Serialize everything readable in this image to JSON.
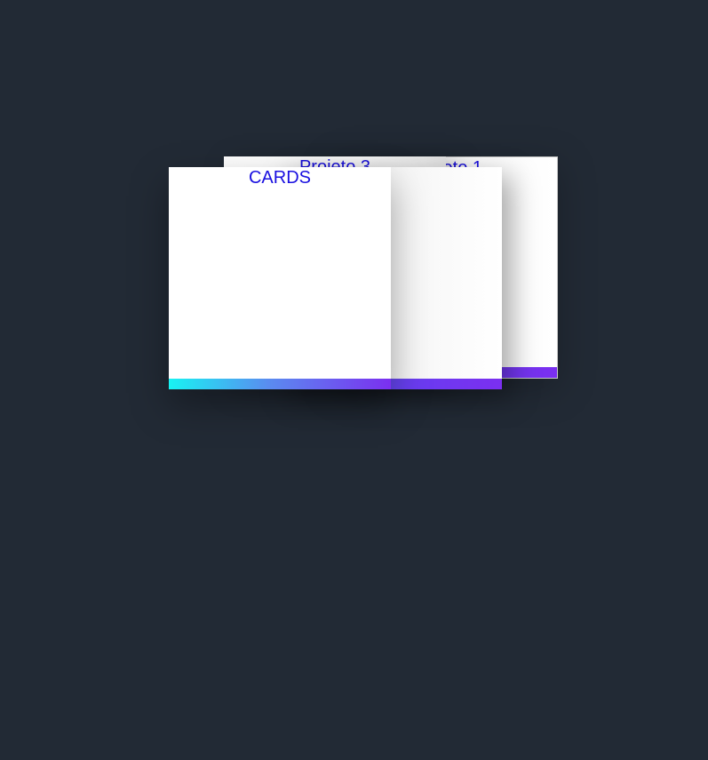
{
  "cards": [
    {
      "title": "Projeto 1"
    },
    {
      "title": "Projeto 3"
    },
    {
      "title": ""
    },
    {
      "title": "CARDS"
    }
  ],
  "colors": {
    "background": "#222a35",
    "card": "#ffffff",
    "title_text": "#1a10e0",
    "bar_start": "#18f3f3",
    "bar_end": "#7b2ff0"
  }
}
